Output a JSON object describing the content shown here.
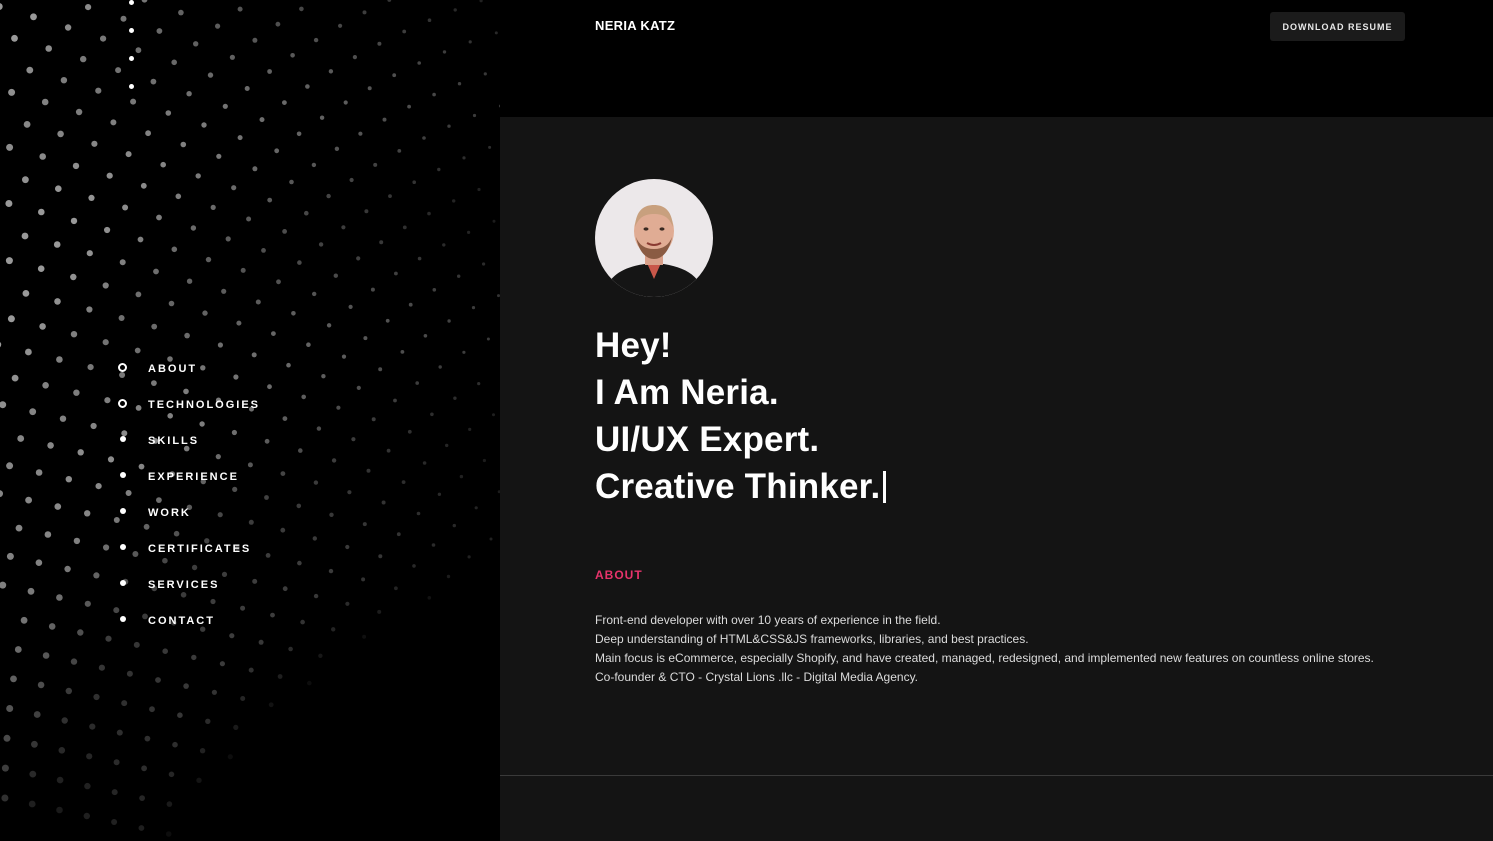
{
  "header": {
    "brand": "NERIA KATZ",
    "download_label": "DOWNLOAD RESUME"
  },
  "nav": {
    "items": [
      {
        "label": "ABOUT",
        "active": true
      },
      {
        "label": "TECHNOLOGIES",
        "active": true
      },
      {
        "label": "SKILLS",
        "active": false
      },
      {
        "label": "EXPERIENCE",
        "active": false
      },
      {
        "label": "WORK",
        "active": false
      },
      {
        "label": "CERTIFICATES",
        "active": false
      },
      {
        "label": "SERVICES",
        "active": false
      },
      {
        "label": "CONTACT",
        "active": false
      }
    ]
  },
  "hero": {
    "line1": "Hey!",
    "line2": "I Am Neria.",
    "line3": "UI/UX Expert.",
    "line4": "Creative Thinker."
  },
  "about": {
    "title": "ABOUT",
    "lines": [
      "Front-end developer with over 10 years of experience in the field.",
      "Deep understanding of HTML&CSS&JS frameworks, libraries, and best practices.",
      "Main focus is eCommerce, especially Shopify, and have created, managed, redesigned, and implemented new features on countless online stores.",
      "Co-founder & CTO - Crystal Lions .llc - Digital Media Agency."
    ]
  },
  "colors": {
    "accent": "#e8336b",
    "panel": "#141414",
    "background": "#000000"
  }
}
